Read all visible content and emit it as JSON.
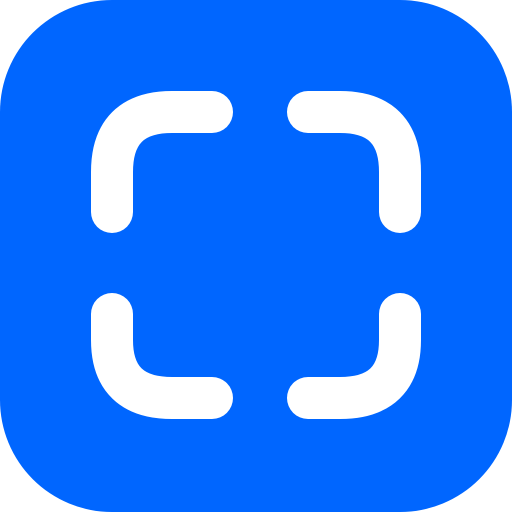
{
  "app_icon": {
    "icon": "scan-frame-icon",
    "background_color": "#0066ff",
    "glyph_color": "#ffffff"
  }
}
